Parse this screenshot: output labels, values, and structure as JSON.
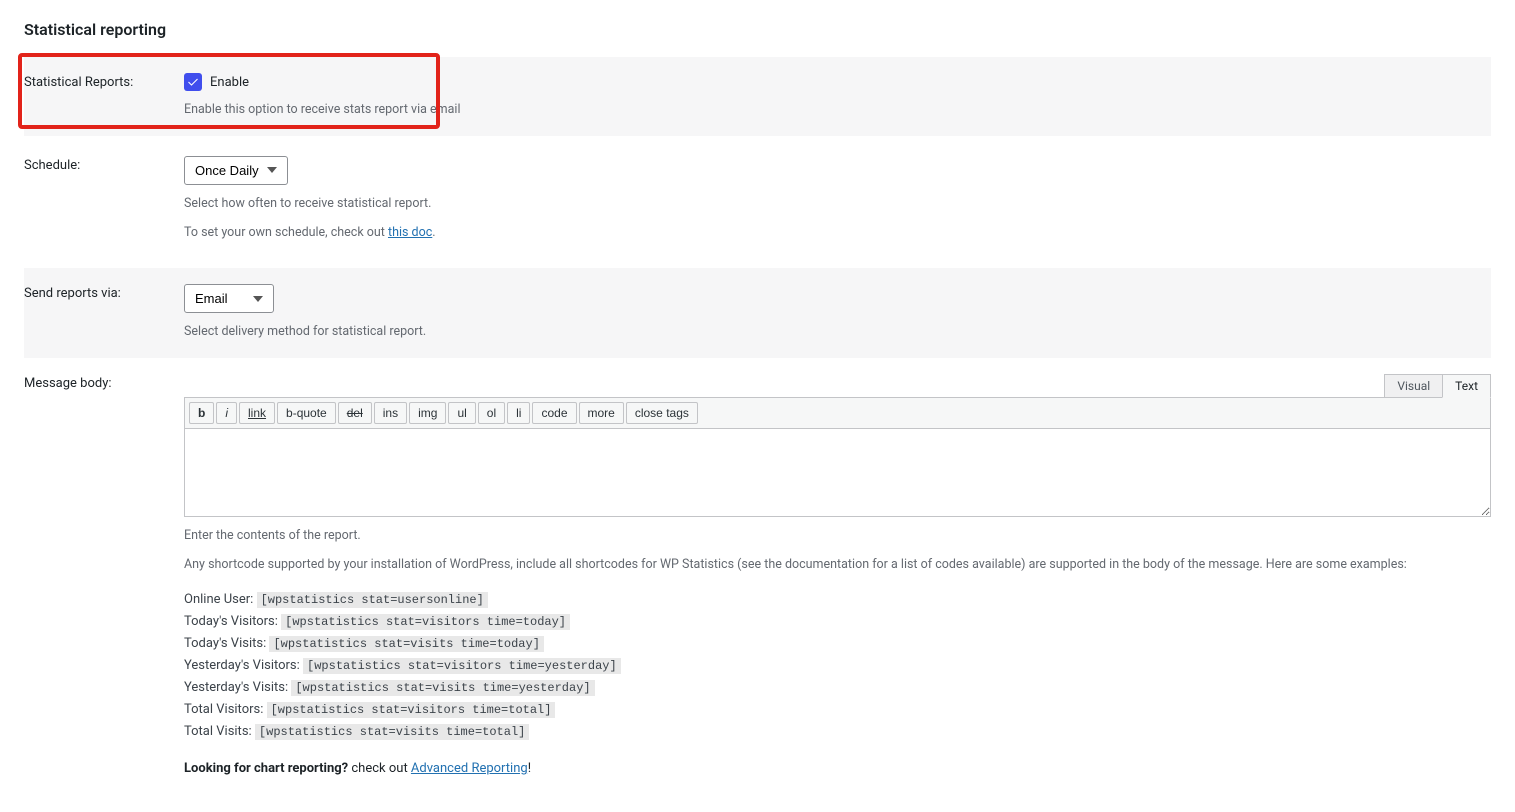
{
  "section_title": "Statistical reporting",
  "reports": {
    "label": "Statistical Reports:",
    "enable_label": "Enable",
    "help": "Enable this option to receive stats report via email"
  },
  "schedule": {
    "label": "Schedule:",
    "value": "Once Daily",
    "help1": "Select how often to receive statistical report.",
    "help2_prefix": "To set your own schedule, check out ",
    "help2_link": "this doc",
    "help2_suffix": "."
  },
  "send_via": {
    "label": "Send reports via:",
    "value": "Email",
    "help": "Select delivery method for statistical report."
  },
  "message": {
    "label": "Message body:",
    "tabs": {
      "visual": "Visual",
      "text": "Text"
    },
    "quicktags": {
      "b": "b",
      "i": "i",
      "link": "link",
      "bquote": "b-quote",
      "del": "del",
      "ins": "ins",
      "img": "img",
      "ul": "ul",
      "ol": "ol",
      "li": "li",
      "code": "code",
      "more": "more",
      "close": "close tags"
    },
    "body_value": "",
    "help1": "Enter the contents of the report.",
    "help2": "Any shortcode supported by your installation of WordPress, include all shortcodes for WP Statistics (see the documentation for a list of codes available) are supported in the body of the message. Here are some examples:"
  },
  "shortcodes": [
    {
      "label": "Online User:",
      "code": "[wpstatistics stat=usersonline]"
    },
    {
      "label": "Today's Visitors:",
      "code": "[wpstatistics stat=visitors time=today]"
    },
    {
      "label": "Today's Visits:",
      "code": "[wpstatistics stat=visits time=today]"
    },
    {
      "label": "Yesterday's Visitors:",
      "code": "[wpstatistics stat=visitors time=yesterday]"
    },
    {
      "label": "Yesterday's Visits:",
      "code": "[wpstatistics stat=visits time=yesterday]"
    },
    {
      "label": "Total Visitors:",
      "code": "[wpstatistics stat=visitors time=total]"
    },
    {
      "label": "Total Visits:",
      "code": "[wpstatistics stat=visits time=total]"
    }
  ],
  "footer": {
    "bold": "Looking for chart reporting?",
    "text": " check out ",
    "link": "Advanced Reporting",
    "suffix": "!"
  }
}
